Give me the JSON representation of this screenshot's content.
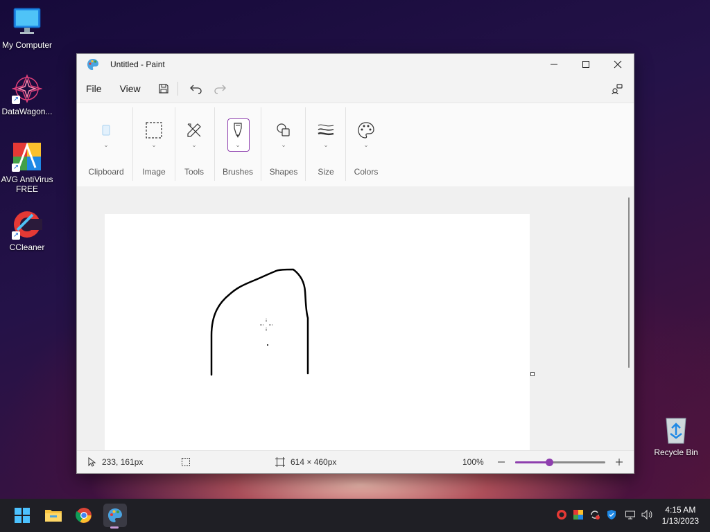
{
  "desktop": {
    "icons": [
      {
        "label": "My Computer"
      },
      {
        "label": "DataWagon..."
      },
      {
        "label": "AVG AntiVirus FREE"
      },
      {
        "label": "CCleaner"
      },
      {
        "label": "Recycle Bin"
      }
    ]
  },
  "window": {
    "title": "Untitled - Paint",
    "buttons": {
      "minimize": "—",
      "maximize": "☐",
      "close": "✕"
    }
  },
  "menubar": {
    "file": "File",
    "view": "View"
  },
  "ribbon": {
    "groups": [
      {
        "label": "Clipboard"
      },
      {
        "label": "Image"
      },
      {
        "label": "Tools"
      },
      {
        "label": "Brushes"
      },
      {
        "label": "Shapes"
      },
      {
        "label": "Size"
      },
      {
        "label": "Colors"
      }
    ]
  },
  "statusbar": {
    "cursor_position": "233, 161px",
    "canvas_size": "614 × 460px",
    "zoom": "100%",
    "zoom_level": 0.38
  },
  "taskbar": {
    "time": "4:15 AM",
    "date": "1/13/2023"
  },
  "colors": {
    "accent": "#8e3fae",
    "taskbar": "#1f1f25"
  }
}
